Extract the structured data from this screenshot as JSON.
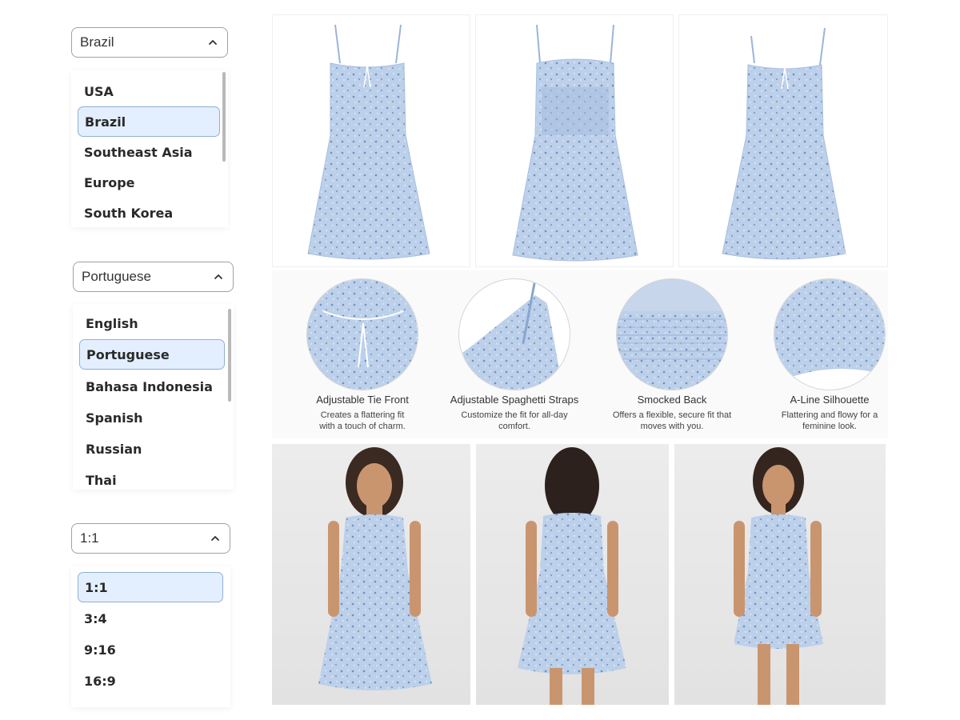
{
  "region_select": {
    "value": "Brazil",
    "options": [
      "USA",
      "Brazil",
      "Southeast Asia",
      "Europe",
      "South Korea"
    ],
    "selected_index": 1
  },
  "language_select": {
    "value": "Portuguese",
    "options": [
      "English",
      "Portuguese",
      "Bahasa Indonesia",
      "Spanish",
      "Russian",
      "Thai"
    ],
    "selected_index": 1
  },
  "ratio_select": {
    "value": "1:1",
    "options": [
      "1:1",
      "3:4",
      "9:16",
      "16:9"
    ],
    "selected_index": 0
  },
  "features": [
    {
      "title": "Adjustable Tie Front",
      "desc_line1": "Creates a flattering fit",
      "desc_line2": "with a touch of charm."
    },
    {
      "title": "Adjustable Spaghetti Straps",
      "desc_line1": "Customize the fit for all-day",
      "desc_line2": "comfort."
    },
    {
      "title": "Smocked Back",
      "desc_line1": "Offers a flexible, secure fit that",
      "desc_line2": "moves with you."
    },
    {
      "title": "A-Line Silhouette",
      "desc_line1": "Flattering and flowy for a",
      "desc_line2": "feminine look."
    }
  ],
  "icons": {
    "dropdown": "chevron-up-icon"
  },
  "colors": {
    "dress_blue": "#b9cde8",
    "dress_print": "#6f8fc4",
    "selected_bg": "#e3efff",
    "selected_border": "#8fb0d4",
    "select_border": "#9aa3ad"
  }
}
